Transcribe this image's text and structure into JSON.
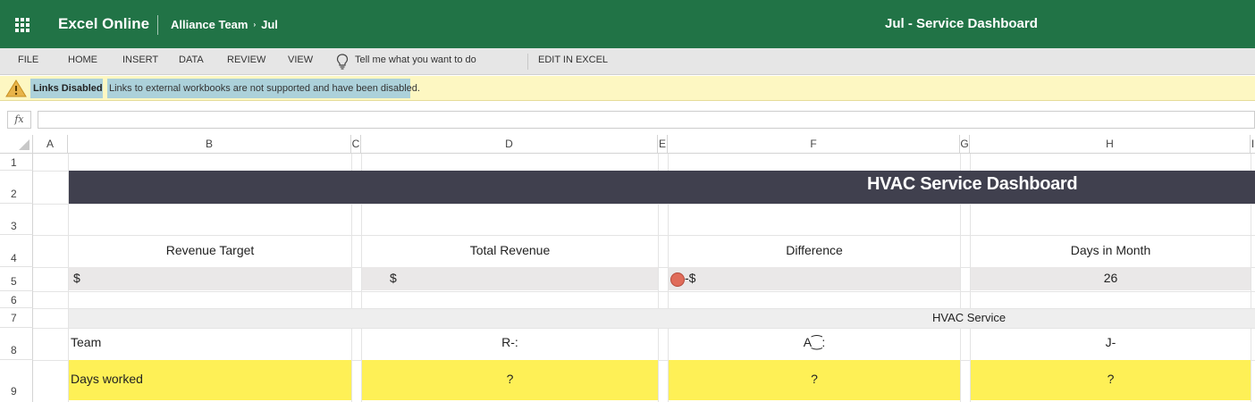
{
  "app": {
    "name": "Excel Online",
    "breadcrumb_team": "Alliance Team",
    "breadcrumb_sep": "›",
    "breadcrumb_item": "Jul",
    "document_title": "Jul - Service Dashboard"
  },
  "menu": {
    "file": "FILE",
    "home": "HOME",
    "insert": "INSERT",
    "data": "DATA",
    "review": "REVIEW",
    "view": "VIEW",
    "tell_me": "Tell me what you want to do",
    "edit_in_excel": "EDIT IN EXCEL"
  },
  "notification": {
    "title": "Links Disabled",
    "message": "Links to external workbooks are not supported and have been disabled."
  },
  "formula_bar": {
    "fx_label": "fx",
    "value": ""
  },
  "columns": [
    "A",
    "B",
    "C",
    "D",
    "E",
    "F",
    "G",
    "H",
    "I"
  ],
  "rows": [
    "1",
    "2",
    "3",
    "4",
    "5",
    "6",
    "7",
    "8",
    "9"
  ],
  "sheet": {
    "banner_title": "HVAC Service Dashboard",
    "headers": {
      "revenue_target": "Revenue Target",
      "total_revenue": "Total Revenue",
      "difference": "Difference",
      "days_in_month": "Days in Month"
    },
    "row5": {
      "revenue_target": "$",
      "total_revenue": "$",
      "difference": "-$",
      "days_in_month": "26"
    },
    "section_title": "HVAC Service",
    "team_label": "Team",
    "team_members": [
      "R-:",
      "A⁐:",
      "J-"
    ],
    "days_worked_label": "Days worked",
    "days_worked_values": [
      "?",
      "?",
      "?"
    ]
  },
  "colors": {
    "brand": "#217346",
    "banner": "#40404e",
    "highlight_yellow": "#fef056",
    "notification_bg": "#fdf7c2",
    "status_dot": "#e06c5a"
  },
  "icons": {
    "app_launcher": "waffle-icon",
    "tell_me": "lightbulb-icon",
    "warning": "warning-icon",
    "difference_status": "red-circle-icon"
  }
}
